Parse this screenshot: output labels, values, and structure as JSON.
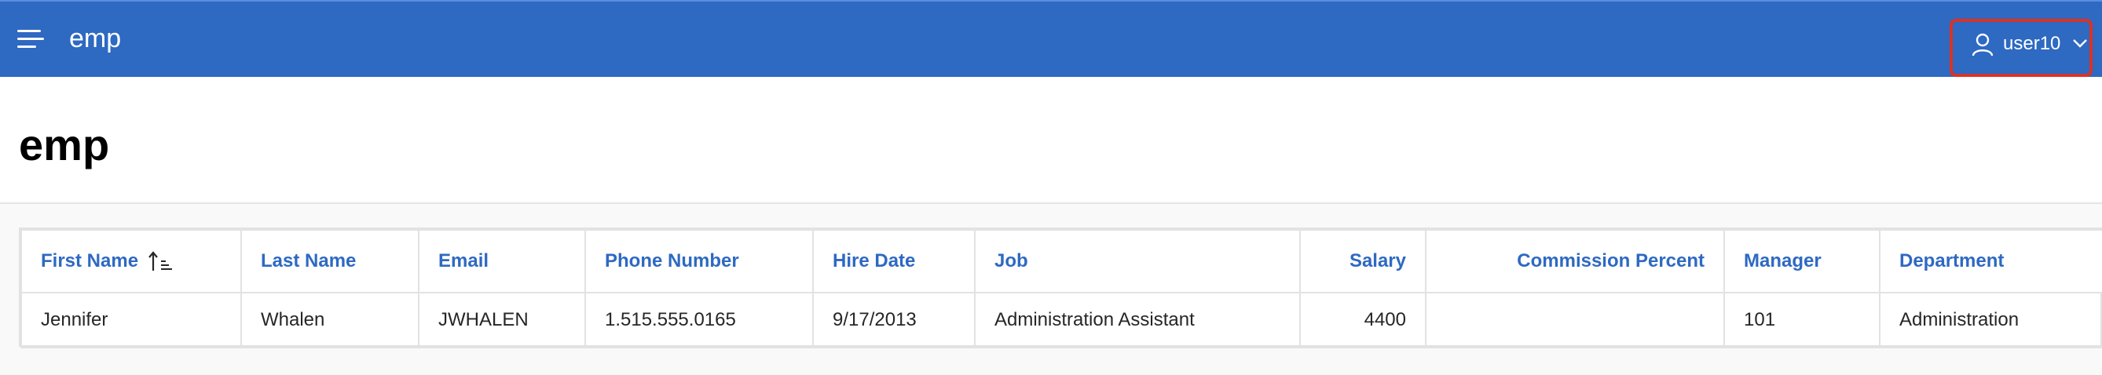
{
  "header": {
    "app_title": "emp",
    "user": {
      "name": "user10",
      "icon": "user-icon",
      "menu_icon": "chevron-down-icon"
    },
    "menu_icon": "hamburger-menu-icon",
    "colors": {
      "bar": "#2e69c2",
      "highlight": "#d93327"
    }
  },
  "page": {
    "title": "emp"
  },
  "report": {
    "columns": [
      {
        "label": "First Name",
        "sorted": "ascending",
        "sort_icon": "sort-ascending-icon"
      },
      {
        "label": "Last Name"
      },
      {
        "label": "Email"
      },
      {
        "label": "Phone Number"
      },
      {
        "label": "Hire Date"
      },
      {
        "label": "Job"
      },
      {
        "label": "Salary"
      },
      {
        "label": "Commission Percent"
      },
      {
        "label": "Manager"
      },
      {
        "label": "Department"
      }
    ],
    "rows": [
      {
        "first_name": "Jennifer",
        "last_name": "Whalen",
        "email": "JWHALEN",
        "phone_number": "1.515.555.0165",
        "hire_date": "9/17/2013",
        "job": "Administration Assistant",
        "salary": "4400",
        "commission_percent": "",
        "manager": "101",
        "department": "Administration"
      }
    ]
  }
}
